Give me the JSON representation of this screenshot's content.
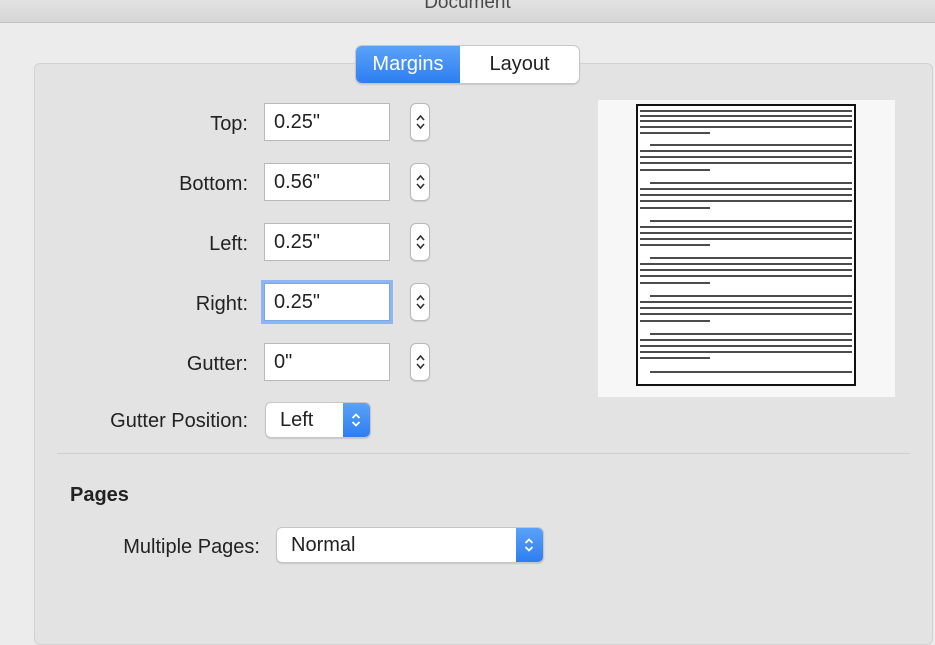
{
  "window": {
    "title": "Document"
  },
  "tabs": [
    {
      "label": "Margins",
      "active": true
    },
    {
      "label": "Layout",
      "active": false
    }
  ],
  "margins": {
    "top": {
      "label": "Top:",
      "value": "0.25\""
    },
    "bottom": {
      "label": "Bottom:",
      "value": "0.56\""
    },
    "left": {
      "label": "Left:",
      "value": "0.25\""
    },
    "right": {
      "label": "Right:",
      "value": "0.25\""
    },
    "gutter": {
      "label": "Gutter:",
      "value": "0\""
    },
    "gutter_position": {
      "label": "Gutter Position:",
      "value": "Left"
    }
  },
  "pages": {
    "title": "Pages",
    "multiple_pages_label": "Multiple Pages:",
    "multiple_pages_value": "Normal"
  },
  "icons": {
    "stepper": "up-down-arrows-icon",
    "popup_caret": "chevron-updown-icon"
  },
  "colors": {
    "accent": "#2e7ef2",
    "focus_ring": "#8fb6f0"
  }
}
